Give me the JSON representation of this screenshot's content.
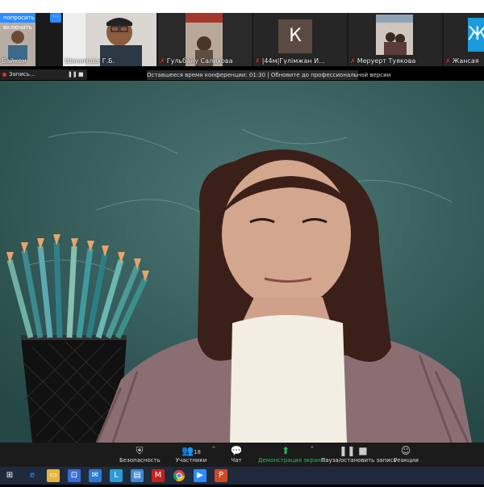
{
  "thumbnails": {
    "ask_to_unmute": "попросить включить",
    "more": "···",
    "participants": [
      {
        "name": "Байкен",
        "muted": false
      },
      {
        "name": "Шакимова Г.Б.",
        "muted": false
      },
      {
        "name": "Гульбану Салихова",
        "muted": true
      },
      {
        "name": "|44м|Гүлімжан И...",
        "muted": true,
        "initial": "К"
      },
      {
        "name": "Меруерт Туякова",
        "muted": true
      },
      {
        "name": "Жансая",
        "muted": true,
        "initial": "Ж"
      }
    ],
    "mute_glyph": "✗"
  },
  "recording": {
    "label": "Запись...",
    "pause": "❚❚",
    "stop": "■"
  },
  "banner": "Оставшееся время конференции: 01:30 | Обновите до профессиональной версии",
  "toolbar": {
    "security": "Безопасность",
    "participants": "Участники",
    "participants_count": "18",
    "chat": "Чат",
    "share_screen": "Демонстрация экрана",
    "pause_stop_recording": "Пауза/остановить запись",
    "reactions": "Реакции",
    "accent_color": "#1fc25a"
  },
  "taskbar": {
    "icons": [
      "windows-icon",
      "search-icon",
      "edge-icon",
      "file-explorer-icon",
      "store-icon",
      "mail-icon",
      "l-app-icon",
      "notes-icon",
      "mcafee-icon",
      "chrome-icon",
      "zoom-icon",
      "powerpoint-icon"
    ]
  }
}
